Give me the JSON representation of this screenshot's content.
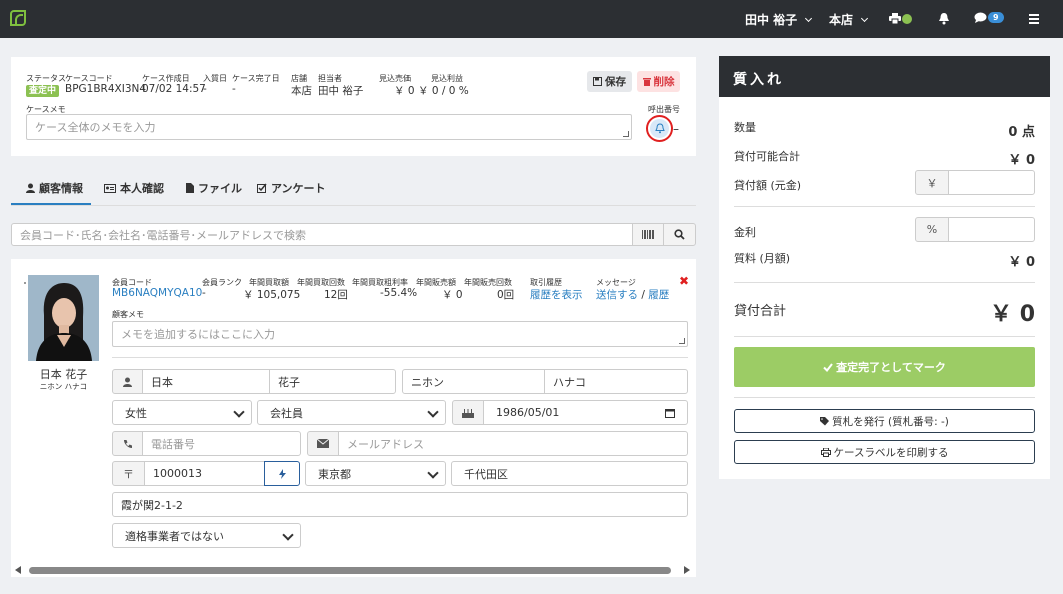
{
  "topbar": {
    "user": "田中 裕子",
    "store": "本店",
    "message_count": "9"
  },
  "case": {
    "status_label": "ステータス",
    "status_value": "査定中",
    "code_label": "ケースコード",
    "code_value": "BPG1BR4XI3N4",
    "created_label": "ケース作成日",
    "created_value": "07/02 14:57",
    "purchase_date_label": "入質日",
    "purchase_date_value": "-",
    "done_date_label": "ケース完了日",
    "done_date_value": "-",
    "store_label": "店舗",
    "store_value": "本店",
    "staff_label": "担当者",
    "staff_value": "田中 裕子",
    "est_sales_label": "見込売価",
    "est_sales_value": "￥ 0",
    "est_profit_label": "見込利益",
    "est_profit_value": "￥ 0 / 0 %",
    "save_label": "保存",
    "delete_label": "削除",
    "memo_label": "ケースメモ",
    "memo_placeholder": "ケース全体のメモを入力",
    "call_number_label": "呼出番号",
    "call_number_value": "–"
  },
  "tabs": [
    {
      "label": "顧客情報"
    },
    {
      "label": "本人確認"
    },
    {
      "label": "ファイル"
    },
    {
      "label": "アンケート"
    }
  ],
  "search": {
    "placeholder": "会員コード･氏名･会社名･電話番号･メールアドレスで検索"
  },
  "customer": {
    "name": "日本 花子",
    "kana": "ニホン ハナコ",
    "member_code_label": "会員コード",
    "member_code_value": "MB6NAQMYQA10",
    "rank_label": "会員ランク",
    "rank_value": "-",
    "annual_buy_amount_label": "年間買取額",
    "annual_buy_amount_value": "￥ 105,075",
    "annual_buy_count_label": "年間買取回数",
    "annual_buy_count_value": "12回",
    "annual_margin_label": "年間買取粗利率",
    "annual_margin_value": "-55.4%",
    "annual_sales_amount_label": "年間販売額",
    "annual_sales_amount_value": "￥ 0",
    "annual_sales_count_label": "年間販売回数",
    "annual_sales_count_value": "0回",
    "history_label": "取引履歴",
    "history_link": "履歴を表示",
    "message_label": "メッセージ",
    "message_send": "送信する",
    "message_sep": "/",
    "message_history": "履歴",
    "memo_label": "顧客メモ",
    "memo_placeholder": "メモを追加するにはここに入力",
    "last_name": "日本",
    "first_name": "花子",
    "last_kana": "ニホン",
    "first_kana": "ハナコ",
    "gender": "女性",
    "job": "会社員",
    "birthday": "1986/05/01",
    "phone_placeholder": "電話番号",
    "email_placeholder": "メールアドレス",
    "postal_mark": "〒",
    "postal": "1000013",
    "prefecture": "東京都",
    "city": "千代田区",
    "address": "霞が関2-1-2",
    "invoice": "適格事業者ではない"
  },
  "purchase": {
    "title": "質入れ",
    "qty_label": "数量",
    "qty_value": "0 点",
    "limit_label": "貸付可能合計",
    "limit_value": "￥ 0",
    "loan_label": "貸付額 (元金)",
    "yen_mark": "￥",
    "interest_label": "金利",
    "percent_mark": "%",
    "fee_label": "質料 (月額)",
    "fee_value": "￥ 0",
    "total_label": "貸付合計",
    "total_value": "￥ 0",
    "complete_button": "査定完了としてマーク",
    "ticket_button": "質札を発行 (質札番号: -)",
    "label_button": "ケースラベルを印刷する"
  }
}
